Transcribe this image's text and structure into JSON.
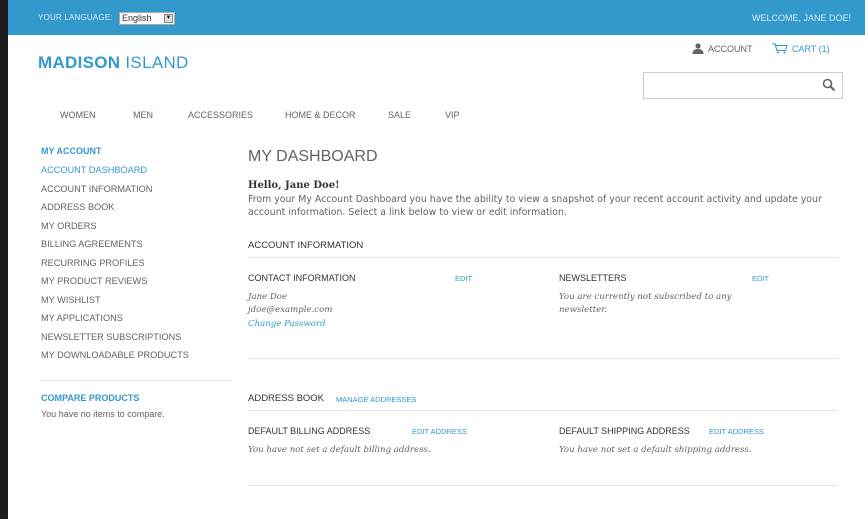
{
  "topbar": {
    "language_label": "YOUR LANGUAGE:",
    "language_value": "English",
    "welcome": "WELCOME, JANE DOE!"
  },
  "header": {
    "logo_bold": "MADISON",
    "logo_light": " ISLAND",
    "account_label": "ACCOUNT",
    "cart_label": "CART (1)",
    "search_placeholder": ""
  },
  "nav": {
    "items": [
      "WOMEN",
      "MEN",
      "ACCESSORIES",
      "HOME & DECOR",
      "SALE",
      "VIP"
    ]
  },
  "sidebar": {
    "title": "MY ACCOUNT",
    "items": [
      {
        "label": "ACCOUNT DASHBOARD"
      },
      {
        "label": "ACCOUNT INFORMATION"
      },
      {
        "label": "ADDRESS BOOK"
      },
      {
        "label": "MY ORDERS"
      },
      {
        "label": "BILLING AGREEMENTS"
      },
      {
        "label": "RECURRING PROFILES"
      },
      {
        "label": "MY PRODUCT REVIEWS"
      },
      {
        "label": "MY WISHLIST"
      },
      {
        "label": "MY APPLICATIONS"
      },
      {
        "label": "NEWSLETTER SUBSCRIPTIONS"
      },
      {
        "label": "MY DOWNLOADABLE PRODUCTS"
      }
    ],
    "compare_title": "COMPARE PRODUCTS",
    "compare_text": "You have no items to compare."
  },
  "main": {
    "title": "MY DASHBOARD",
    "hello": "Hello, Jane Doe!",
    "intro": "From your My Account Dashboard you have the ability to view a snapshot of your recent account activity and update your account information. Select a link below to view or edit information.",
    "account_info_title": "ACCOUNT INFORMATION",
    "contact": {
      "title": "CONTACT INFORMATION",
      "edit": "EDIT",
      "name": "Jane Doe",
      "email": "jdoe@example.com",
      "change_password": "Change Password"
    },
    "newsletters": {
      "title": "NEWSLETTERS",
      "edit": "EDIT",
      "text": "You are currently not subscribed to any newsletter."
    },
    "address_book": {
      "title": "ADDRESS BOOK",
      "manage": "MANAGE ADDRESSES",
      "billing_title": "DEFAULT BILLING ADDRESS",
      "billing_edit": "EDIT ADDRESS",
      "billing_text": "You have not set a default billing address.",
      "shipping_title": "DEFAULT SHIPPING ADDRESS",
      "shipping_edit": "EDIT ADDRESS",
      "shipping_text": "You have not set a default shipping address."
    }
  },
  "colors": {
    "accent": "#3399cc",
    "text": "#636363"
  },
  "icons": {
    "account": "user-icon",
    "cart": "cart-icon",
    "search": "search-icon",
    "dropdown": "chevron-down-icon"
  }
}
